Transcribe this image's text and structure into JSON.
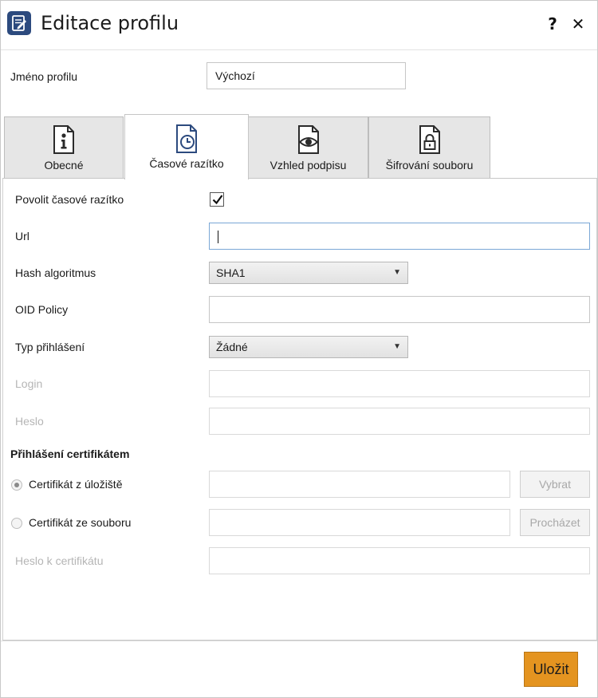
{
  "window": {
    "title": "Editace profilu",
    "help_label": "?",
    "close_label": "✕",
    "app_icon": "document-edit-icon"
  },
  "profile": {
    "name_label": "Jméno profilu",
    "name_value": "Výchozí"
  },
  "tabs": [
    {
      "label": "Obecné",
      "icon": "document-info-icon",
      "active": false
    },
    {
      "label": "Časové razítko",
      "icon": "document-clock-icon",
      "active": true
    },
    {
      "label": "Vzhled podpisu",
      "icon": "document-eye-icon",
      "active": false
    },
    {
      "label": "Šifrování souboru",
      "icon": "document-lock-icon",
      "active": false
    }
  ],
  "timestamp": {
    "enable_label": "Povolit časové razítko",
    "enable_checked": true,
    "url_label": "Url",
    "url_value": "",
    "hash_label": "Hash algoritmus",
    "hash_value": "SHA1",
    "oid_label": "OID Policy",
    "oid_value": "",
    "login_type_label": "Typ přihlášení",
    "login_type_value": "Žádné",
    "login_label": "Login",
    "password_label": "Heslo"
  },
  "certificate": {
    "section_title": "Přihlášení certifikátem",
    "from_store_label": "Certifikát z úložiště",
    "from_store_selected": true,
    "select_button": "Vybrat",
    "from_file_label": "Certifikát ze souboru",
    "from_file_selected": false,
    "browse_button": "Procházet",
    "cert_password_label": "Heslo k certifikátu"
  },
  "footer": {
    "save_label": "Uložit"
  },
  "colors": {
    "accent": "#e49420",
    "icon_blue": "#2c4a7e"
  }
}
